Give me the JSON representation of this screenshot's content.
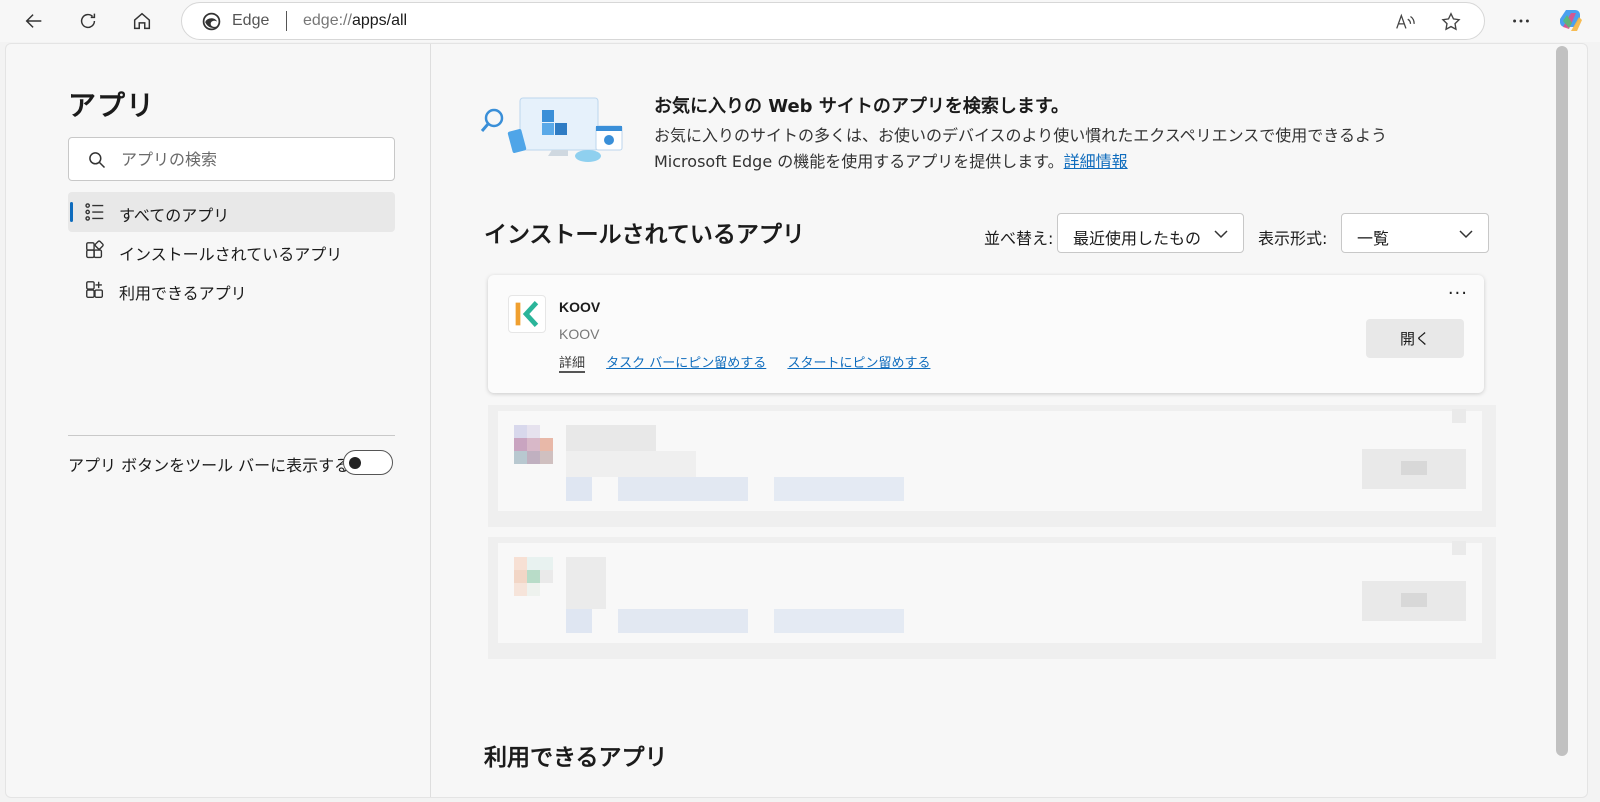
{
  "browser": {
    "site_name": "Edge",
    "url_prefix": "edge://",
    "url_path": "apps/all"
  },
  "sidebar": {
    "title": "アプリ",
    "search_placeholder": "アプリの検索",
    "items": [
      {
        "label": "すべてのアプリ",
        "icon": "list-icon",
        "active": true
      },
      {
        "label": "インストールされているアプリ",
        "icon": "apps-icon",
        "active": false
      },
      {
        "label": "利用できるアプリ",
        "icon": "apps-add-icon",
        "active": false
      }
    ],
    "toggle_label": "アプリ ボタンをツール バーに表示する",
    "toggle_on": false
  },
  "promo": {
    "title": "お気に入りの Web サイトのアプリを検索します。",
    "description": "お気に入りのサイトの多くは、お使いのデバイスのより使い慣れたエクスペリエンスで使用できるよう Microsoft Edge の機能を使用するアプリを提供します。",
    "link": "詳細情報"
  },
  "installed": {
    "title": "インストールされているアプリ",
    "sort_label": "並べ替え:",
    "sort_value": "最近使用したもの",
    "view_label": "表示形式:",
    "view_value": "一覧",
    "apps": [
      {
        "name": "KOOV",
        "publisher": "KOOV",
        "link_detail": "詳細",
        "link_taskbar": "タスク バーにピン留めする",
        "link_start": "スタートにピン留めする",
        "more": "···",
        "open_label": "開く"
      }
    ]
  },
  "available": {
    "title": "利用できるアプリ"
  },
  "colors": {
    "accent": "#0f6cbd",
    "koov_orange": "#f0a030",
    "koov_green": "#2bb59a"
  }
}
